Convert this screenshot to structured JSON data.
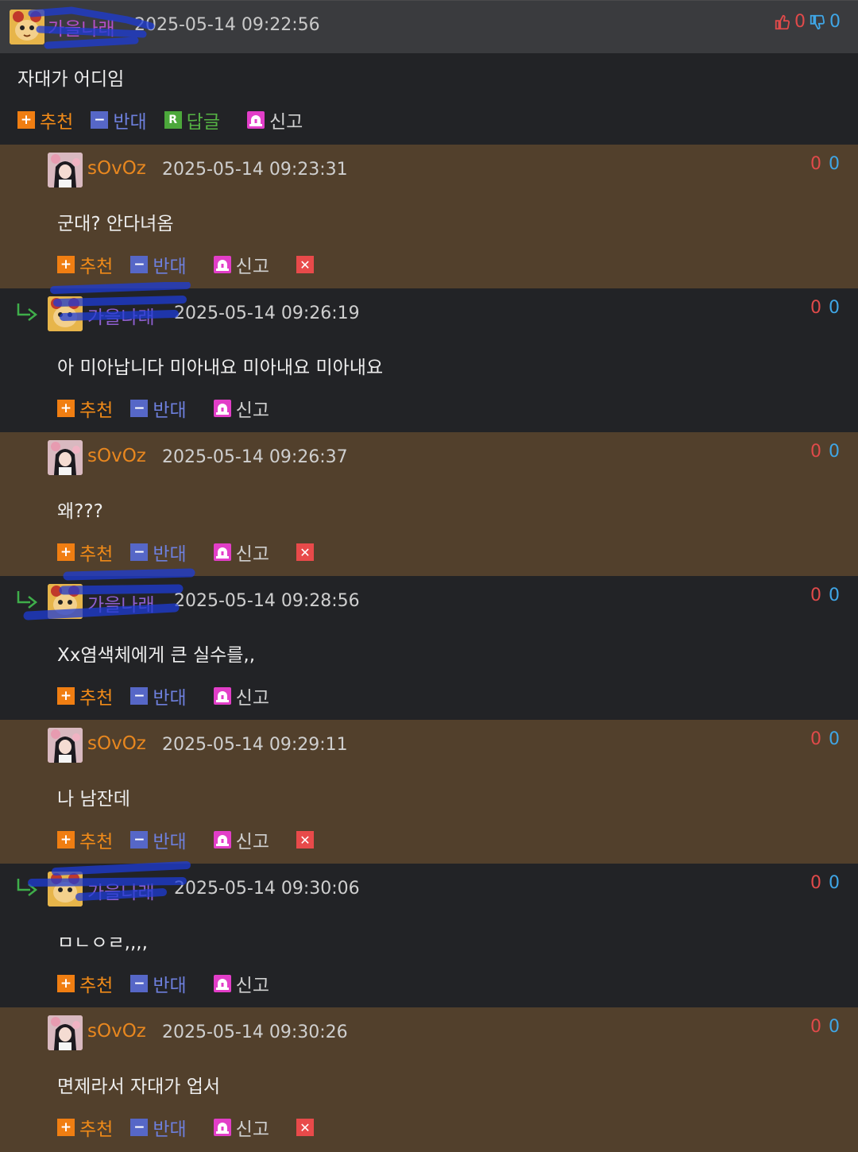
{
  "root": {
    "author": "가을나래",
    "time": "2025-05-14 09:22:56",
    "body": "자대가 어디임",
    "up_count": "0",
    "down_count": "0",
    "actions": {
      "up": "추천",
      "down": "반대",
      "reply": "답글",
      "report": "신고"
    }
  },
  "replies": [
    {
      "author": "sOvOz",
      "time": "2025-05-14 09:23:31",
      "body": "군대? 안다녀옴",
      "up": "0",
      "down": "0"
    },
    {
      "author": "가을나래",
      "time": "2025-05-14 09:26:19",
      "body": "아 미아납니다 미아내요 미아내요 미아내요",
      "up": "0",
      "down": "0"
    },
    {
      "author": "sOvOz",
      "time": "2025-05-14 09:26:37",
      "body": "왜???",
      "up": "0",
      "down": "0"
    },
    {
      "author": "가을나래",
      "time": "2025-05-14 09:28:56",
      "body": "Xx염색체에게 큰 실수를,,",
      "up": "0",
      "down": "0"
    },
    {
      "author": "sOvOz",
      "time": "2025-05-14 09:29:11",
      "body": "나 남잔데",
      "up": "0",
      "down": "0"
    },
    {
      "author": "가을나래",
      "time": "2025-05-14 09:30:06",
      "body": "ㅁㄴㅇㄹ,,,,",
      "up": "0",
      "down": "0"
    },
    {
      "author": "sOvOz",
      "time": "2025-05-14 09:30:26",
      "body": "면제라서 자대가 업서",
      "up": "0",
      "down": "0"
    }
  ],
  "actions": {
    "up": "추천",
    "down": "반대",
    "report": "신고"
  },
  "icons": {
    "up": "plus-icon",
    "down": "minus-icon",
    "reply": "reply-r-icon",
    "report": "siren-icon",
    "delete": "close-icon",
    "reply_arrow": "reply-arrow-icon",
    "thumb_up": "thumbs-up-icon",
    "thumb_down": "thumbs-down-icon"
  },
  "colors": {
    "brown_row": "#52402c",
    "dark_row": "#222326",
    "header": "#3a3b3e",
    "up": "#f07e12",
    "down": "#5667c7",
    "reply": "#4ca83b",
    "report": "#e23ec8",
    "vote_up": "#e04a4a",
    "vote_down": "#3fa6e6",
    "redaction": "#1e3cd6"
  }
}
